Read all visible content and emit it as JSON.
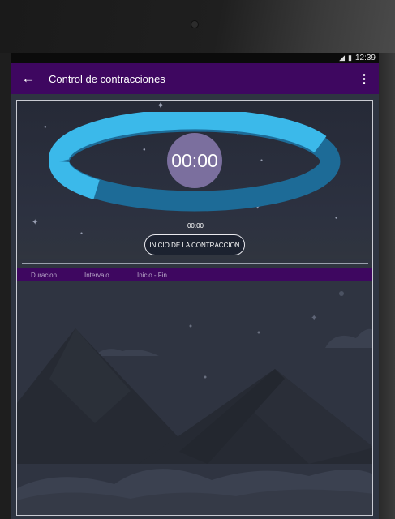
{
  "status_bar": {
    "signal_icon": "signal-icon",
    "battery_icon": "battery-icon",
    "time": "12:39"
  },
  "app_bar": {
    "back_icon": "arrow-back-icon",
    "title": "Control de contracciones",
    "overflow_icon": "more-vert-icon",
    "color": "#3e0760"
  },
  "timer": {
    "display": "00:00",
    "secondary_display": "00:00",
    "ring_colors": [
      "#3bb9ea",
      "#1d6b97"
    ],
    "circle_color": "#7b6f9e"
  },
  "start_button": {
    "label": "INICIO DE LA CONTRACCION"
  },
  "table": {
    "columns": [
      "Duracion",
      "Intervalo",
      "Inicio - Fin"
    ],
    "rows": []
  }
}
